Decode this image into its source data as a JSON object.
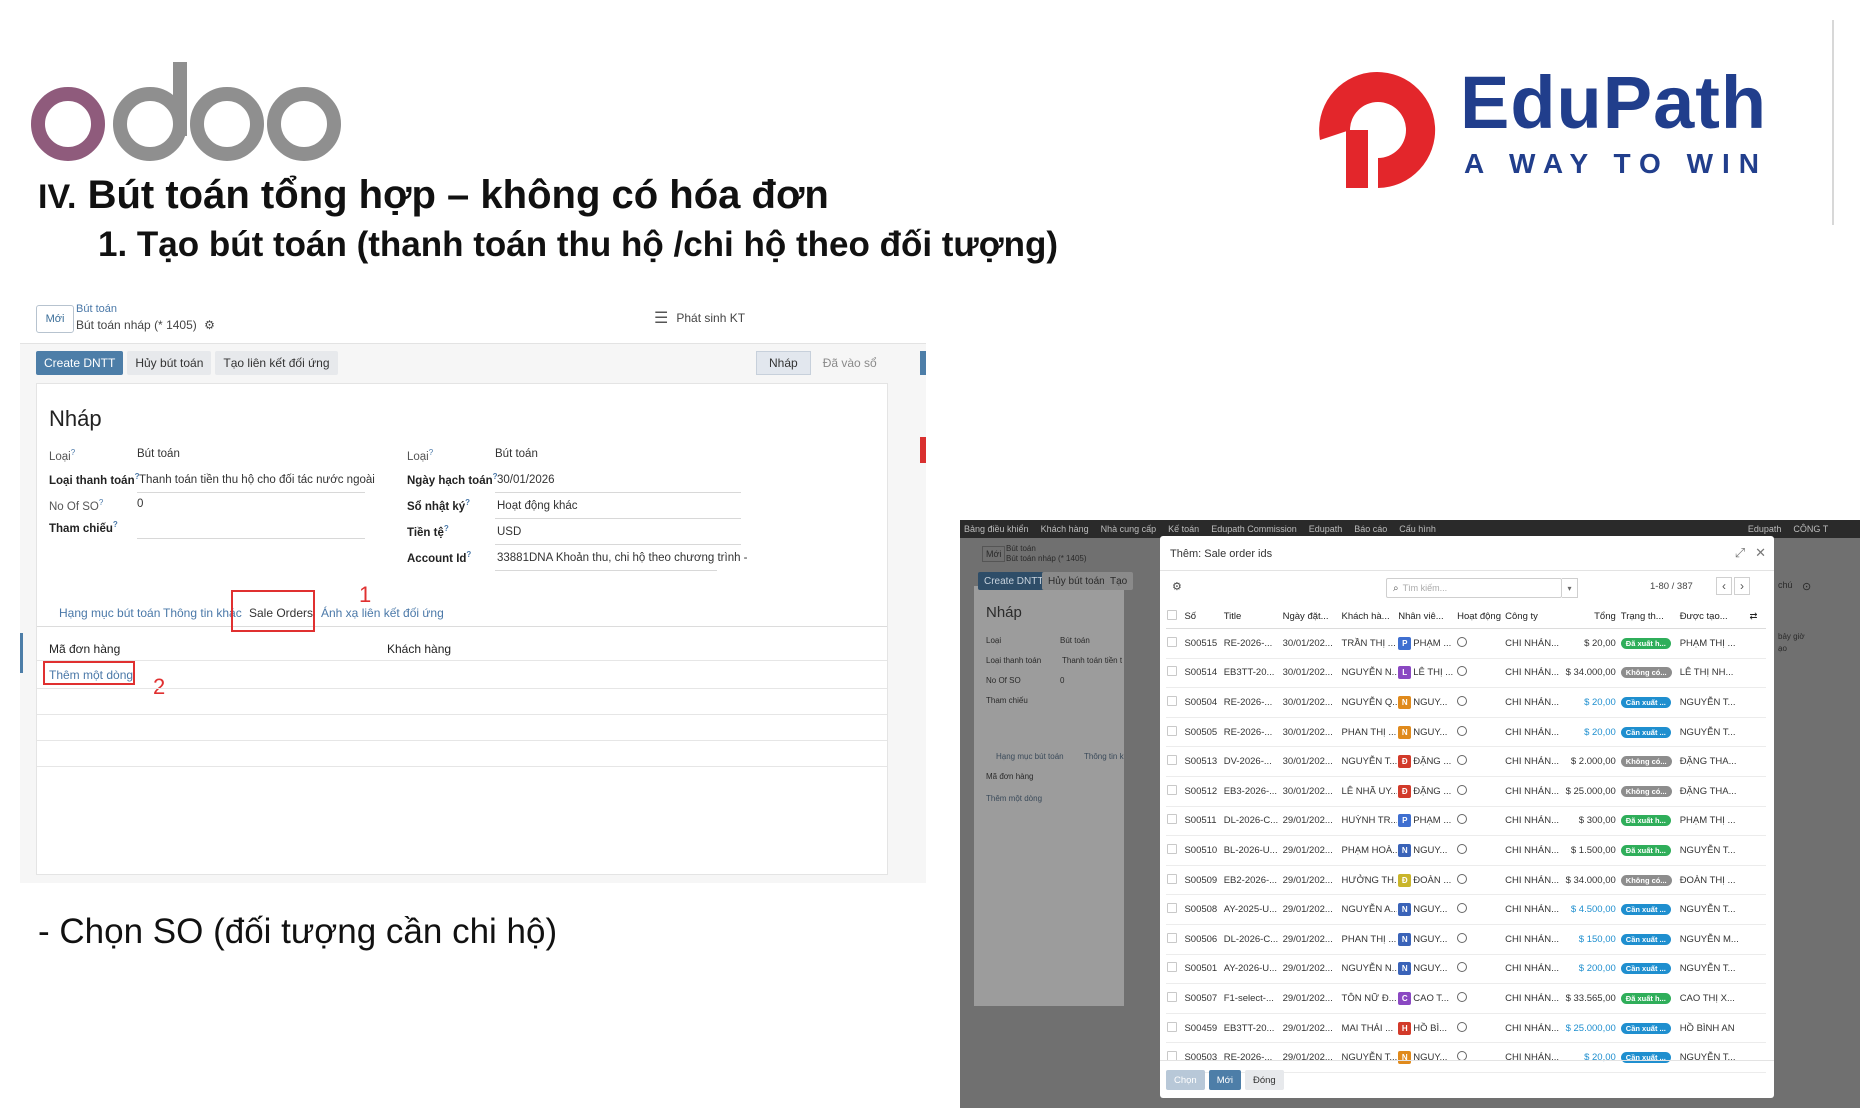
{
  "branding": {
    "odoo_wordmark": "odoo",
    "edupath_name": "EduPath",
    "edupath_tagline": "A WAY TO WIN"
  },
  "colors": {
    "odoo_purple": "#8f5b7c",
    "odoo_gray": "#8f8f8f",
    "edupath_red": "#e3262b",
    "edupath_navy": "#213e8c",
    "odoo_primary": "#4d7ea8",
    "annotation_red": "#e03030"
  },
  "slide": {
    "heading_roman": "IV.",
    "heading_text": "Bút toán tổng hợp – không có hóa đơn",
    "subheading": "1. Tạo bút toán (thanh toán thu hộ /chi hộ theo đối tượng)",
    "caption": "- Chọn SO (đối tượng cần chi hộ)"
  },
  "left_screen": {
    "new_button": "Mới",
    "breadcrumb_parent": "Bút toán",
    "breadcrumb_current": "Bút toán nháp (* 1405)",
    "phat_sinh_button": "Phát sinh KT",
    "actions": [
      "Create DNTT",
      "Hủy bút toán",
      "Tạo liên kết đối ứng"
    ],
    "statuses": [
      "Nháp",
      "Đã vào sổ"
    ],
    "record_title": "Nháp",
    "fields_left": [
      {
        "label": "Loại",
        "value": "Bút toán"
      },
      {
        "label": "Loại thanh toán",
        "value": "Thanh toán tiền thu hộ cho đối tác nước ngoài"
      },
      {
        "label": "No Of SO",
        "value": "0"
      },
      {
        "label": "Tham chiếu",
        "value": ""
      }
    ],
    "fields_right": [
      {
        "label": "Loại",
        "value": "Bút toán"
      },
      {
        "label": "Ngày hạch toán",
        "value": "30/01/2026"
      },
      {
        "label": "Sổ nhật ký",
        "value": "Hoạt động khác"
      },
      {
        "label": "Tiền tệ",
        "value": "USD"
      },
      {
        "label": "Account Id",
        "value": "33881DNA Khoản thu, chi hộ theo chương trình -"
      }
    ],
    "tabs": [
      "Hạng mục bút toán",
      "Thông tin khác",
      "Sale Orders",
      "Ánh xạ liên kết đối ứng"
    ],
    "columns": [
      "Mã đơn hàng",
      "Khách hàng"
    ],
    "add_line": "Thêm một dòng",
    "annotations": [
      "1",
      "2"
    ]
  },
  "right_screen": {
    "background": {
      "nav": [
        "Bảng điều khiển",
        "Khách hàng",
        "Nhà cung cấp",
        "Kế toán",
        "Edupath Commission",
        "Edupath",
        "Báo cáo",
        "Cấu hình"
      ],
      "nav_right": [
        "Edupath",
        "CÔNG T"
      ],
      "new_button": "Mới",
      "breadcrumb_parent": "Bút toán",
      "breadcrumb_current": "Bút toán nháp (* 1405)",
      "actions": [
        "Create DNTT",
        "Hủy bút toán",
        "Tạo"
      ],
      "record_title": "Nháp",
      "labels": [
        "Loại",
        "Loại thanh toán",
        "No Of SO",
        "Tham chiếu"
      ],
      "values": [
        "Bút toán",
        "Thanh toán tiền t",
        "0"
      ],
      "tabs": [
        "Hạng mục bút toán",
        "Thông tin k"
      ],
      "column": "Mã đơn hàng",
      "add_line": "Thêm một dòng",
      "side_text_1": "chú",
      "side_text_2": "bảy giờ",
      "side_text_3": "ạo"
    },
    "dialog": {
      "title": "Thêm: Sale order ids",
      "search_placeholder": "Tìm kiếm...",
      "pager": "1-80 / 387",
      "headers": [
        "Số",
        "Title",
        "Ngày đặt...",
        "Khách hà...",
        "Nhân viê...",
        "Hoạt động",
        "Công ty",
        "Tổng",
        "Trạng th...",
        "Được tạo..."
      ],
      "rows": [
        {
          "so": "S00515",
          "title": "RE-2026-...",
          "date": "30/01/202...",
          "customer": "TRẦN THỊ ...",
          "av": "P",
          "avc": "#3f6fd0",
          "emp": "PHẠM ...",
          "company": "CHI NHÁN...",
          "total": "$ 20,00",
          "blue": false,
          "status": "Đã xuất h...",
          "sc": "#2fae5a",
          "creator": "PHẠM THỊ ..."
        },
        {
          "so": "S00514",
          "title": "EB3TT-20...",
          "date": "30/01/202...",
          "customer": "NGUYỄN N...",
          "av": "L",
          "avc": "#8a48c2",
          "emp": "LÊ THỊ ...",
          "company": "CHI NHÁN...",
          "total": "$ 34.000,00",
          "blue": false,
          "status": "Không có...",
          "sc": "#8d8d8d",
          "creator": "LÊ THỊ NH..."
        },
        {
          "so": "S00504",
          "title": "RE-2026-...",
          "date": "30/01/202...",
          "customer": "NGUYỄN Q...",
          "av": "N",
          "avc": "#e08a1c",
          "emp": "NGUY...",
          "company": "CHI NHÁN...",
          "total": "$ 20,00",
          "blue": true,
          "status": "Cần xuất ...",
          "sc": "#1f8fcf",
          "creator": "NGUYỄN T..."
        },
        {
          "so": "S00505",
          "title": "RE-2026-...",
          "date": "30/01/202...",
          "customer": "PHAN THỊ ...",
          "av": "N",
          "avc": "#e08a1c",
          "emp": "NGUY...",
          "company": "CHI NHÁN...",
          "total": "$ 20,00",
          "blue": true,
          "status": "Cần xuất ...",
          "sc": "#1f8fcf",
          "creator": "NGUYỄN T..."
        },
        {
          "so": "S00513",
          "title": "DV-2026-...",
          "date": "30/01/202...",
          "customer": "NGUYỄN T...",
          "av": "Đ",
          "avc": "#d23a2a",
          "emp": "ĐẶNG ...",
          "company": "CHI NHÁN...",
          "total": "$ 2.000,00",
          "blue": false,
          "status": "Không có...",
          "sc": "#8d8d8d",
          "creator": "ĐẶNG THA..."
        },
        {
          "so": "S00512",
          "title": "EB3-2026-...",
          "date": "30/01/202...",
          "customer": "LÊ NHÃ UY...",
          "av": "Đ",
          "avc": "#d23a2a",
          "emp": "ĐẶNG ...",
          "company": "CHI NHÁN...",
          "total": "$ 25.000,00",
          "blue": false,
          "status": "Không có...",
          "sc": "#8d8d8d",
          "creator": "ĐẶNG THA..."
        },
        {
          "so": "S00511",
          "title": "DL-2026-C...",
          "date": "29/01/202...",
          "customer": "HUỲNH TR...",
          "av": "P",
          "avc": "#3f6fd0",
          "emp": "PHẠM ...",
          "company": "CHI NHÁN...",
          "total": "$ 300,00",
          "blue": false,
          "status": "Đã xuất h...",
          "sc": "#2fae5a",
          "creator": "PHẠM THỊ ..."
        },
        {
          "so": "S00510",
          "title": "BL-2026-U...",
          "date": "29/01/202...",
          "customer": "PHẠM HOÀ...",
          "av": "N",
          "avc": "#3a63b8",
          "emp": "NGUY...",
          "company": "CHI NHÁN...",
          "total": "$ 1.500,00",
          "blue": false,
          "status": "Đã xuất h...",
          "sc": "#2fae5a",
          "creator": "NGUYỄN T..."
        },
        {
          "so": "S00509",
          "title": "EB2-2026-...",
          "date": "29/01/202...",
          "customer": "HƯỞNG TH...",
          "av": "Đ",
          "avc": "#c9b52b",
          "emp": "ĐOÀN ...",
          "company": "CHI NHÁN...",
          "total": "$ 34.000,00",
          "blue": false,
          "status": "Không có...",
          "sc": "#8d8d8d",
          "creator": "ĐOÀN THỊ ..."
        },
        {
          "so": "S00508",
          "title": "AY-2025-U...",
          "date": "29/01/202...",
          "customer": "NGUYỄN A...",
          "av": "N",
          "avc": "#3a63b8",
          "emp": "NGUY...",
          "company": "CHI NHÁN...",
          "total": "$ 4.500,00",
          "blue": true,
          "status": "Cần xuất ...",
          "sc": "#1f8fcf",
          "creator": "NGUYỄN T..."
        },
        {
          "so": "S00506",
          "title": "DL-2026-C...",
          "date": "29/01/202...",
          "customer": "PHAN THỊ ...",
          "av": "N",
          "avc": "#3a63b8",
          "emp": "NGUY...",
          "company": "CHI NHÁN...",
          "total": "$ 150,00",
          "blue": true,
          "status": "Cần xuất ...",
          "sc": "#1f8fcf",
          "creator": "NGUYỄN M..."
        },
        {
          "so": "S00501",
          "title": "AY-2026-U...",
          "date": "29/01/202...",
          "customer": "NGUYỄN N...",
          "av": "N",
          "avc": "#3a63b8",
          "emp": "NGUY...",
          "company": "CHI NHÁN...",
          "total": "$ 200,00",
          "blue": true,
          "status": "Cần xuất ...",
          "sc": "#1f8fcf",
          "creator": "NGUYỄN T..."
        },
        {
          "so": "S00507",
          "title": "F1-select-...",
          "date": "29/01/202...",
          "customer": "TÔN NỮ Đ...",
          "av": "C",
          "avc": "#8a48c2",
          "emp": "CAO T...",
          "company": "CHI NHÁN...",
          "total": "$ 33.565,00",
          "blue": false,
          "status": "Đã xuất h...",
          "sc": "#2fae5a",
          "creator": "CAO THỊ X..."
        },
        {
          "so": "S00459",
          "title": "EB3TT-20...",
          "date": "29/01/202...",
          "customer": "MAI THÁI ...",
          "av": "H",
          "avc": "#d23a2a",
          "emp": "HỒ BÌ...",
          "company": "CHI NHÁN...",
          "total": "$ 25.000,00",
          "blue": true,
          "status": "Cần xuất ...",
          "sc": "#1f8fcf",
          "creator": "HỒ BÌNH AN"
        },
        {
          "so": "S00503",
          "title": "RE-2026-...",
          "date": "29/01/202...",
          "customer": "NGUYỄN T...",
          "av": "N",
          "avc": "#e08a1c",
          "emp": "NGUY...",
          "company": "CHI NHÁN...",
          "total": "$ 20,00",
          "blue": true,
          "status": "Cần xuất ...",
          "sc": "#1f8fcf",
          "creator": "NGUYỄN T..."
        }
      ],
      "footer": [
        "Chọn",
        "Mới",
        "Đóng"
      ]
    }
  }
}
